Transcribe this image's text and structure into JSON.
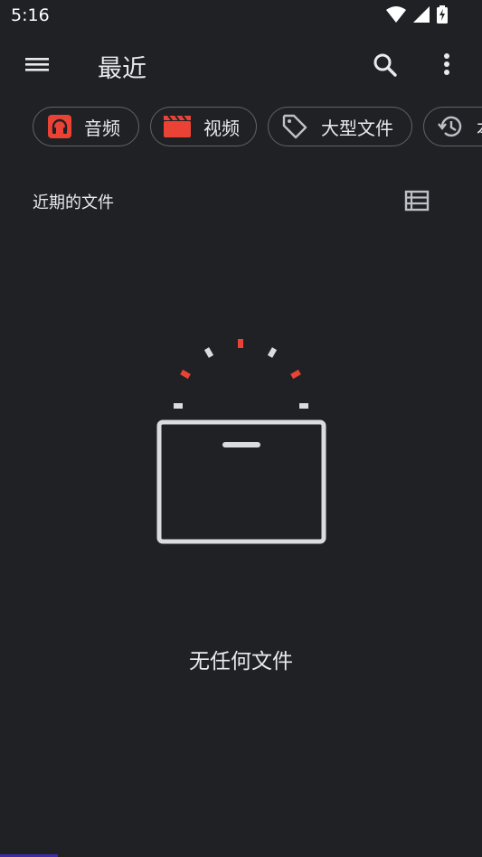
{
  "status_bar": {
    "time": "5:16"
  },
  "toolbar": {
    "title": "最近"
  },
  "chips": [
    {
      "label": "音频",
      "icon": "headphones-icon",
      "color": "#ea4335"
    },
    {
      "label": "视频",
      "icon": "clapperboard-icon",
      "color": "#ea4335"
    },
    {
      "label": "大型文件",
      "icon": "tag-icon"
    },
    {
      "label": "本",
      "icon": "history-icon"
    }
  ],
  "section": {
    "title": "近期的文件"
  },
  "empty_state": {
    "message": "无任何文件"
  },
  "colors": {
    "background": "#202124",
    "accent_red": "#ea4335",
    "text": "#e8eaed",
    "chip_border": "#5f6368"
  }
}
